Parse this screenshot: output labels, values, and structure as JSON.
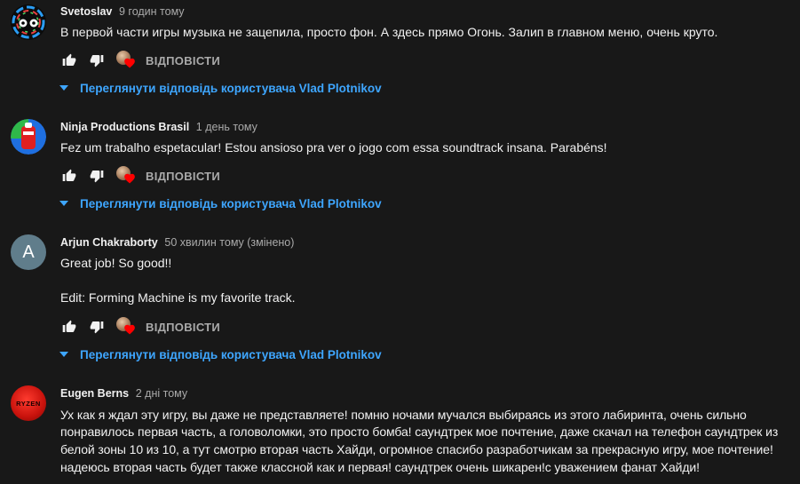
{
  "comments": [
    {
      "author": "Svetoslav",
      "time": "9 годин тому",
      "lines": [
        "В первой части игры музыка не зацепила, просто фон. А здесь прямо Огонь. Залип в главном меню, очень круто."
      ],
      "reply_label": "ВІДПОВІСТИ",
      "view_replies": "Переглянути відповідь користувача Vlad Plotnikov"
    },
    {
      "author": "Ninja Productions Brasil",
      "time": "1 день тому",
      "lines": [
        "Fez um trabalho espetacular! Estou ansioso pra ver o jogo com essa soundtrack insana. Parabéns!"
      ],
      "reply_label": "ВІДПОВІСТИ",
      "view_replies": "Переглянути відповідь користувача Vlad Plotnikov"
    },
    {
      "author": "Arjun Chakraborty",
      "time": "50 хвилин тому (змінено)",
      "avatar_letter": "A",
      "lines": [
        "Great job! So good!!",
        "",
        "Edit: Forming Machine is my favorite track."
      ],
      "reply_label": "ВІДПОВІСТИ",
      "view_replies": "Переглянути відповідь користувача Vlad Plotnikov"
    },
    {
      "author": "Eugen Berns",
      "time": "2 дні тому",
      "avatar_text": "RYZEN",
      "lines": [
        "Ух как я ждал эту игру, вы даже не представляете! помню ночами мучался выбираясь из этого лабиринта, очень сильно",
        "понравилось первая часть, а головоломки, это просто бомба! саундтрек мое почтение, даже скачал на телефон саундтрек из",
        "белой зоны 10 из 10, а тут смотрю вторая часть Хайди, огромное спасибо разработчикам за прекрасную игру, мое почтение!",
        "надеюсь вторая часть будет также классной как и первая! саундтрек очень шикарен!с уважением фанат Хайди!"
      ]
    }
  ],
  "colors": {
    "background": "#181818",
    "text": "#f1f1f1",
    "secondary": "#aaaaaa",
    "link": "#3ea6ff",
    "heart": "#ff0000"
  },
  "icons": {
    "like": "thumb-up-icon",
    "dislike": "thumb-down-icon",
    "creator_heart": "creator-heart-icon",
    "expand": "caret-down-icon"
  }
}
